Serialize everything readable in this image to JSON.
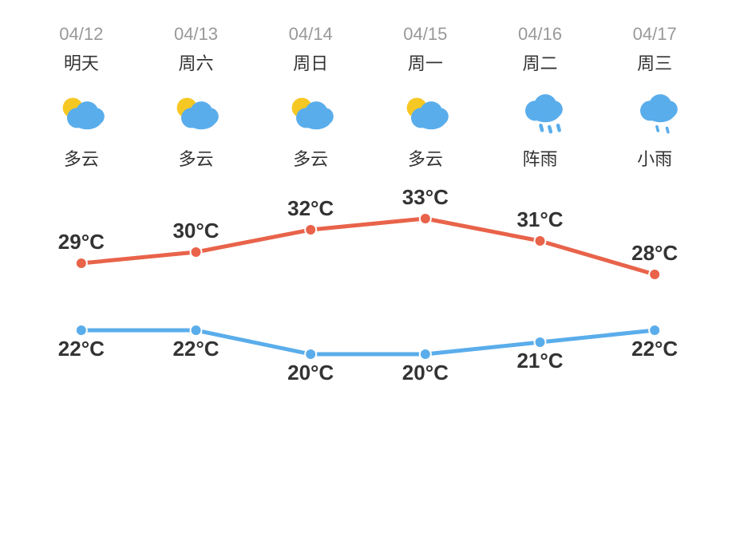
{
  "days": [
    {
      "date": "04/12",
      "name": "明天",
      "desc": "多云",
      "icon": "partly_cloudy",
      "high": 29,
      "low": 22
    },
    {
      "date": "04/13",
      "name": "周六",
      "desc": "多云",
      "icon": "partly_cloudy",
      "high": 30,
      "low": 22
    },
    {
      "date": "04/14",
      "name": "周日",
      "desc": "多云",
      "icon": "partly_cloudy",
      "high": 32,
      "low": 20
    },
    {
      "date": "04/15",
      "name": "周一",
      "desc": "多云",
      "icon": "partly_cloudy",
      "high": 33,
      "low": 20
    },
    {
      "date": "04/16",
      "name": "周二",
      "desc": "阵雨",
      "icon": "rain",
      "high": 31,
      "low": 21
    },
    {
      "date": "04/17",
      "name": "周三",
      "desc": "小雨",
      "icon": "light_rain",
      "high": 28,
      "low": 22
    }
  ],
  "colors": {
    "high_line": "#E8634A",
    "low_line": "#5AADEB",
    "date_color": "#999999",
    "text_color": "#333333"
  }
}
